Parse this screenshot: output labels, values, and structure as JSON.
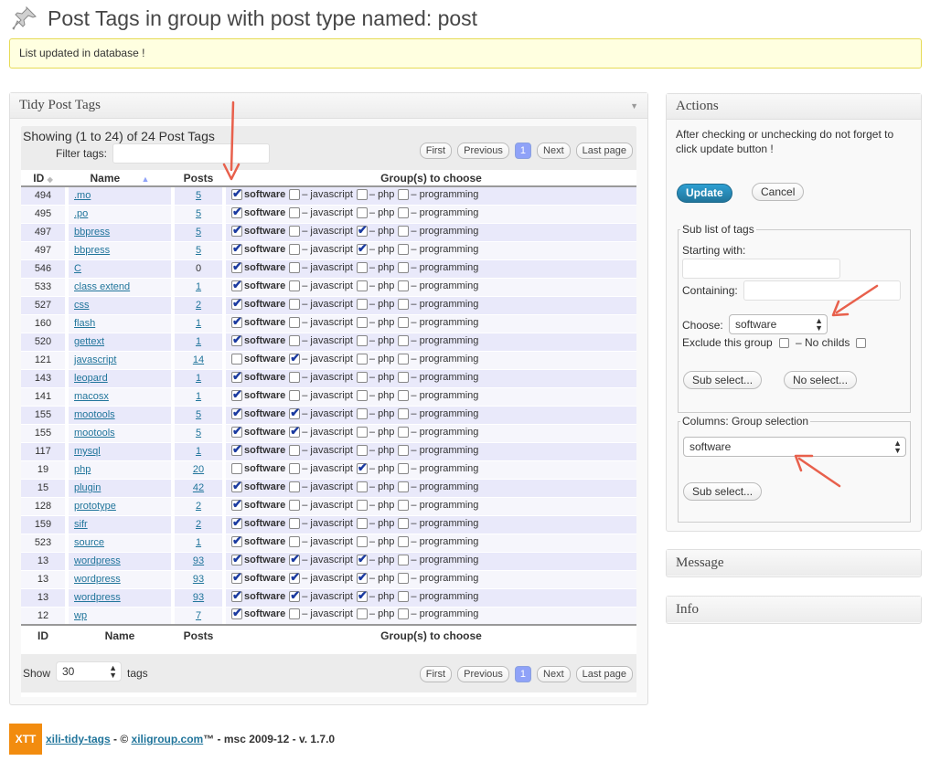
{
  "page": {
    "title": "Post Tags in group with post type named: post",
    "notice": "List updated in database !"
  },
  "tidy": {
    "box_title": "Tidy Post Tags",
    "showing": "Showing (1 to 24) of 24 Post Tags",
    "filter_label": "Filter tags:",
    "filter_value": "",
    "pager": {
      "first": "First",
      "previous": "Previous",
      "current": "1",
      "next": "Next",
      "last": "Last page"
    },
    "columns": {
      "id": "ID",
      "name": "Name",
      "posts": "Posts",
      "groups": "Group(s) to choose"
    },
    "group_labels": [
      "software",
      "– javascript",
      "– php",
      "– programming"
    ],
    "rows": [
      {
        "id": "494",
        "name": ".mo",
        "posts": "5",
        "groups": [
          true,
          false,
          false,
          false
        ]
      },
      {
        "id": "495",
        "name": ".po",
        "posts": "5",
        "groups": [
          true,
          false,
          false,
          false
        ]
      },
      {
        "id": "497",
        "name": "bbpress",
        "posts": "5",
        "groups": [
          true,
          false,
          true,
          false
        ]
      },
      {
        "id": "497",
        "name": "bbpress",
        "posts": "5",
        "groups": [
          true,
          false,
          true,
          false
        ]
      },
      {
        "id": "546",
        "name": "C",
        "posts": "0",
        "groups": [
          true,
          false,
          false,
          false
        ]
      },
      {
        "id": "533",
        "name": "class extend",
        "posts": "1",
        "groups": [
          true,
          false,
          false,
          false
        ]
      },
      {
        "id": "527",
        "name": "css",
        "posts": "2",
        "groups": [
          true,
          false,
          false,
          false
        ]
      },
      {
        "id": "160",
        "name": "flash",
        "posts": "1",
        "groups": [
          true,
          false,
          false,
          false
        ]
      },
      {
        "id": "520",
        "name": "gettext",
        "posts": "1",
        "groups": [
          true,
          false,
          false,
          false
        ]
      },
      {
        "id": "121",
        "name": "javascript",
        "posts": "14",
        "groups": [
          false,
          true,
          false,
          false
        ]
      },
      {
        "id": "143",
        "name": "leopard",
        "posts": "1",
        "groups": [
          true,
          false,
          false,
          false
        ]
      },
      {
        "id": "141",
        "name": "macosx",
        "posts": "1",
        "groups": [
          true,
          false,
          false,
          false
        ]
      },
      {
        "id": "155",
        "name": "mootools",
        "posts": "5",
        "groups": [
          true,
          true,
          false,
          false
        ]
      },
      {
        "id": "155",
        "name": "mootools",
        "posts": "5",
        "groups": [
          true,
          true,
          false,
          false
        ]
      },
      {
        "id": "117",
        "name": "mysql",
        "posts": "1",
        "groups": [
          true,
          false,
          false,
          false
        ]
      },
      {
        "id": "19",
        "name": "php",
        "posts": "20",
        "groups": [
          false,
          false,
          true,
          false
        ]
      },
      {
        "id": "15",
        "name": "plugin",
        "posts": "42",
        "groups": [
          true,
          false,
          false,
          false
        ]
      },
      {
        "id": "128",
        "name": "prototype",
        "posts": "2",
        "groups": [
          true,
          false,
          false,
          false
        ]
      },
      {
        "id": "159",
        "name": "sifr",
        "posts": "2",
        "groups": [
          true,
          false,
          false,
          false
        ]
      },
      {
        "id": "523",
        "name": "source",
        "posts": "1",
        "groups": [
          true,
          false,
          false,
          false
        ]
      },
      {
        "id": "13",
        "name": "wordpress",
        "posts": "93",
        "groups": [
          true,
          true,
          true,
          false
        ]
      },
      {
        "id": "13",
        "name": "wordpress",
        "posts": "93",
        "groups": [
          true,
          true,
          true,
          false
        ]
      },
      {
        "id": "13",
        "name": "wordpress",
        "posts": "93",
        "groups": [
          true,
          true,
          true,
          false
        ]
      },
      {
        "id": "12",
        "name": "wp",
        "posts": "7",
        "groups": [
          true,
          false,
          false,
          false
        ]
      }
    ],
    "show_label": "Show",
    "show_value": "30",
    "tags_label": "tags"
  },
  "actions": {
    "box_title": "Actions",
    "note": "After checking or unchecking do not forget to click update button !",
    "update": "Update",
    "cancel": "Cancel",
    "sublist": {
      "legend": "Sub list of tags",
      "starting_with": "Starting with:",
      "containing": "Containing:",
      "choose": "Choose:",
      "choose_value": "software",
      "exclude": "Exclude this group",
      "no_childs": "– No childs",
      "sub_select": "Sub select...",
      "no_select": "No select..."
    },
    "columns": {
      "legend": "Columns: Group selection",
      "value": "software",
      "sub_select": "Sub select..."
    }
  },
  "message": {
    "box_title": "Message"
  },
  "info": {
    "box_title": "Info"
  },
  "footer": {
    "logo": "XTT",
    "plugin": "xili-tidy-tags",
    "sep": " - © ",
    "link": "xiligroup.com",
    "rest": "™ - msc 2009-12 - v. 1.7.0"
  },
  "colors": {
    "accent": "#21759b",
    "arrow": "#e8604c",
    "row_odd": "#e9e9fa",
    "notice_bg": "#ffffe0"
  }
}
